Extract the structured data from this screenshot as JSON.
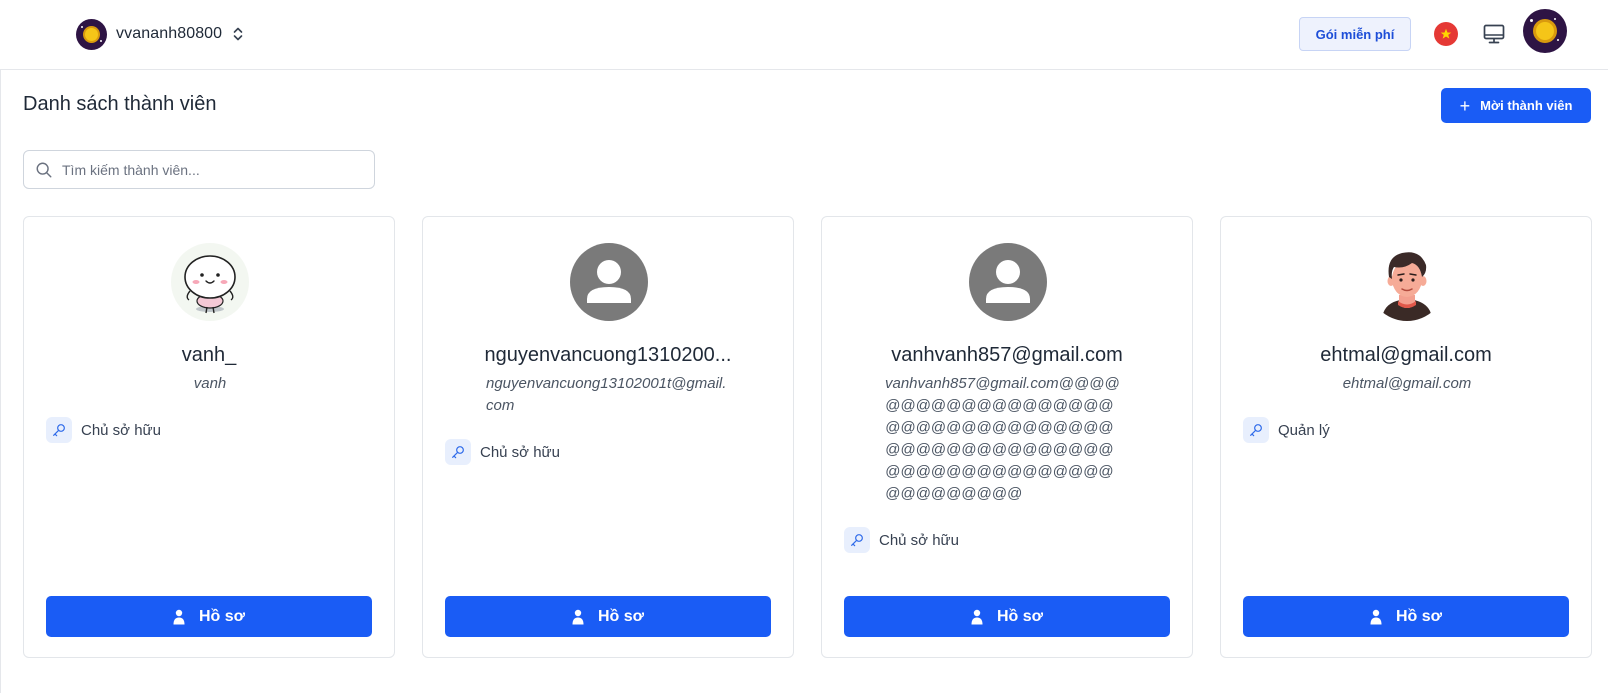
{
  "header": {
    "workspace_name": "vvananh80800",
    "plan_label": "Gói miễn phí"
  },
  "page": {
    "title": "Danh sách thành viên",
    "add_button_label": "Mời thành viên"
  },
  "search": {
    "placeholder": "Tìm kiếm thành viên..."
  },
  "members": [
    {
      "name": "vanh_",
      "email": "vanh",
      "role": "Chủ sở hữu",
      "avatar": "cartoon-mochi",
      "button": "Hồ sơ"
    },
    {
      "name": "nguyenvancuong1310200...",
      "email": "nguyenvancuong13102001t@gmail.com",
      "role": "Chủ sở hữu",
      "avatar": "default-user",
      "button": "Hồ sơ"
    },
    {
      "name": "vanhvanh857@gmail.com",
      "email": "vanhvanh857@gmail.com@@@@@@@@@@@@@@@@@@@@@@@@@@@@@@@@@@@@@@@@@@@@@@@@@@@@@@@@@@@@@@@@@@@@@@@@@",
      "role": "Chủ sở hữu",
      "avatar": "default-user",
      "button": "Hồ sơ"
    },
    {
      "name": "ehtmal@gmail.com",
      "email": "ehtmal@gmail.com",
      "role": "Quản lý",
      "avatar": "cartoon-man",
      "button": "Hồ sơ"
    }
  ],
  "colors": {
    "primary": "#1a5cf5",
    "flag_red": "#e53935",
    "avatar_bg": "#2e1444"
  },
  "icons": {
    "workspace_switch": "chevron-up-down-icon",
    "language": "vietnam-flag-icon",
    "display": "monitor-icon",
    "search": "search-icon",
    "role": "key-icon",
    "profile": "user-icon",
    "add": "plus-icon"
  }
}
